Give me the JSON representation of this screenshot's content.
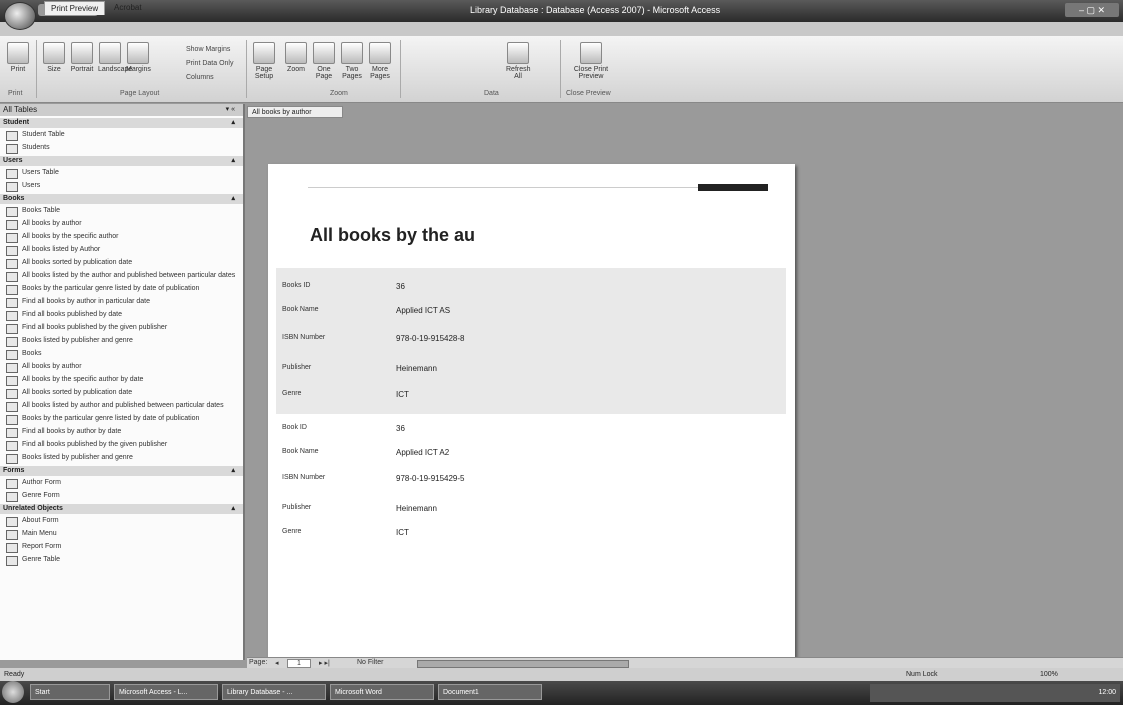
{
  "window": {
    "title": "Library Database : Database (Access 2007) - Microsoft Access"
  },
  "ribbon": {
    "tabs": [
      "Print Preview",
      "Acrobat"
    ],
    "groups": [
      {
        "label": "Print",
        "buttons": [
          "Print"
        ]
      },
      {
        "label": "Page Layout",
        "buttons": [
          "Size",
          "Portrait",
          "Landscape",
          "Margins"
        ]
      },
      {
        "label": "Zoom",
        "buttons": [
          "Page Setup",
          "Zoom",
          "One Page",
          "Two Pages",
          "More Pages"
        ]
      },
      {
        "label": "Data",
        "buttons": [
          "Refresh All"
        ]
      },
      {
        "label": "Close Preview",
        "buttons": [
          "Close Print Preview"
        ]
      }
    ],
    "small_buttons": [
      "Show Margins",
      "Print Data Only",
      "Columns"
    ]
  },
  "nav": {
    "header": "All Tables",
    "groups": [
      {
        "name": "Student",
        "items": [
          "Student Table",
          "Students"
        ]
      },
      {
        "name": "Users",
        "items": [
          "Users Table",
          "Users"
        ]
      },
      {
        "name": "Books",
        "items": [
          "Books Table",
          "All books by author",
          "All books by the specific author",
          "All books listed by Author",
          "All books sorted by publication date",
          "All books listed by the author and published between particular dates",
          "Books by the particular genre listed by date of publication",
          "Find all books by author in particular date",
          "Find all books published by date",
          "Find all books published by the given publisher",
          "Books listed by publisher and genre",
          "Books",
          "All books by author",
          "All books by the specific author by date",
          "All books sorted by publication date",
          "All books listed by author and published between particular dates",
          "Books by the particular genre listed by date of publication",
          "Find all books by author by date",
          "Find all books published by the given publisher",
          "Books listed by publisher and genre"
        ]
      },
      {
        "name": "Forms",
        "items": [
          "Author Form",
          "Genre Form"
        ]
      },
      {
        "name": "Unrelated Objects",
        "items": [
          "About Form",
          "Main Menu",
          "Report Form",
          "Genre Table"
        ]
      }
    ]
  },
  "document": {
    "tab_label": "All books by author",
    "report_title": "All books by the au",
    "records": [
      {
        "fields": [
          {
            "label": "Books ID",
            "value": "36"
          },
          {
            "label": "Book Name",
            "value": "Applied ICT AS"
          },
          {
            "label": "ISBN Number",
            "value": "978-0-19-915428-8"
          },
          {
            "label": "Publisher",
            "value": "Heinemann"
          },
          {
            "label": "Genre",
            "value": "ICT"
          }
        ]
      },
      {
        "fields": [
          {
            "label": "Book ID",
            "value": "36"
          },
          {
            "label": "Book Name",
            "value": "Applied ICT A2"
          },
          {
            "label": "ISBN Number",
            "value": "978-0-19-915429-5"
          },
          {
            "label": "Publisher",
            "value": "Heinemann"
          },
          {
            "label": "Genre",
            "value": "ICT"
          }
        ]
      }
    ]
  },
  "record_nav": {
    "label": "Page:",
    "current": "1",
    "filter": "No Filter"
  },
  "status": {
    "left": "Ready",
    "right": "Num Lock",
    "zoom": "100%"
  },
  "taskbar": {
    "items": [
      "Start",
      "Microsoft Access - L...",
      "Library Database - ...",
      "Microsoft Word",
      "Document1"
    ],
    "clock": "12:00"
  }
}
